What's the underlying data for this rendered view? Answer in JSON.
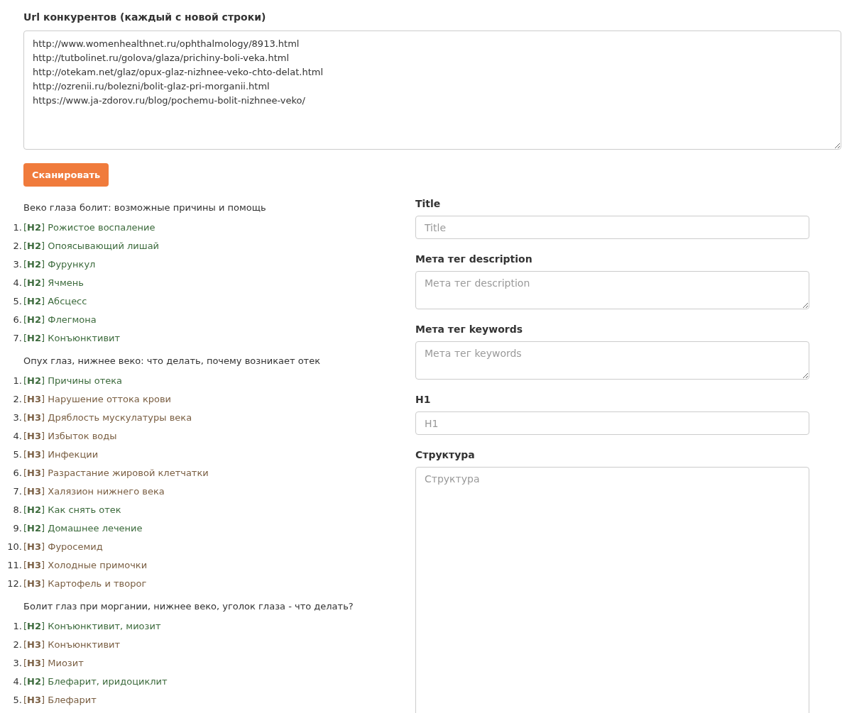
{
  "competitors": {
    "label": "Url конкурентов (каждый с новой строки)",
    "urls": [
      "http://www.womenhealthnet.ru/ophthalmology/8913.html",
      "http://tutbolinet.ru/golova/glaza/prichiny-boli-veka.html",
      "http://otekam.net/glaz/opux-glaz-nizhnee-veko-chto-delat.html",
      "http://ozrenii.ru/bolezni/bolit-glaz-pri-morganii.html",
      "https://www.ja-zdorov.ru/blog/pochemu-bolit-nizhnee-veko/"
    ]
  },
  "scan_button": "Сканировать",
  "pages": [
    {
      "title": "Веко глаза болит: возможные причины и помощь",
      "headings": [
        {
          "number": "1.",
          "kind": "h2",
          "text": "[**H2**] Рожистое воспаление"
        },
        {
          "number": "2.",
          "kind": "h2",
          "text": "[**H2**] Опоясывающий лишай"
        },
        {
          "number": "3.",
          "kind": "h2",
          "text": "[**H2**] Фурункул"
        },
        {
          "number": "4.",
          "kind": "h2",
          "text": "[**H2**] Ячмень"
        },
        {
          "number": "5.",
          "kind": "h2",
          "text": "[**H2**] Абсцесс"
        },
        {
          "number": "6.",
          "kind": "h2",
          "text": "[**H2**] Флегмона"
        },
        {
          "number": "7.",
          "kind": "h2",
          "text": "[**H2**] Конъюнктивит"
        }
      ]
    },
    {
      "title": "Опух глаз, нижнее веко: что делать, почему возникает отек",
      "headings": [
        {
          "number": "1.",
          "kind": "h2",
          "text": "[**H2**] Причины отека"
        },
        {
          "number": "2.",
          "kind": "h3",
          "text": "[**H3**] Нарушение оттока крови"
        },
        {
          "number": "3.",
          "kind": "h3",
          "text": "[**H3**] Дряблость мускулатуры века"
        },
        {
          "number": "4.",
          "kind": "h3",
          "text": "[**H3**] Избыток воды"
        },
        {
          "number": "5.",
          "kind": "h3",
          "text": "[**H3**] Инфекции"
        },
        {
          "number": "6.",
          "kind": "h3",
          "text": "[**H3**] Разрастание жировой клетчатки"
        },
        {
          "number": "7.",
          "kind": "h3",
          "text": "[**H3**] Халязион нижнего века"
        },
        {
          "number": "8.",
          "kind": "h2",
          "text": "[**H2**] Как снять отек"
        },
        {
          "number": "9.",
          "kind": "h2",
          "text": "[**H2**] Домашнее лечение"
        },
        {
          "number": "10.",
          "kind": "h3",
          "text": "[**H3**] Фуросемид"
        },
        {
          "number": "11.",
          "kind": "h3",
          "text": "[**H3**] Холодные примочки"
        },
        {
          "number": "12.",
          "kind": "h3",
          "text": "[**H3**] Картофель и творог"
        }
      ]
    },
    {
      "title": "Болит глаз при моргании, нижнее веко, уголок глаза - что делать?",
      "headings": [
        {
          "number": "1.",
          "kind": "h2",
          "text": "[**H2**] Конъюнктивит, миозит"
        },
        {
          "number": "2.",
          "kind": "h3",
          "text": "[**H3**] Конъюнктивит"
        },
        {
          "number": "3.",
          "kind": "h3",
          "text": "[**H3**] Миозит"
        },
        {
          "number": "4.",
          "kind": "h2",
          "text": "[**H2**] Блефарит, иридоциклит"
        },
        {
          "number": "5.",
          "kind": "h3",
          "text": "[**H3**] Блефарит"
        }
      ]
    }
  ],
  "fields": [
    {
      "kind": "input",
      "label": "Title",
      "placeholder": "Title"
    },
    {
      "kind": "textarea",
      "label": "Мета тег description",
      "placeholder": "Мета тег description"
    },
    {
      "kind": "textarea",
      "label": "Мета тег keywords",
      "placeholder": "Мета тег keywords"
    },
    {
      "kind": "input",
      "label": "H1",
      "placeholder": "H1"
    },
    {
      "kind": "tall",
      "label": "Структура",
      "placeholder": "Структура"
    }
  ]
}
